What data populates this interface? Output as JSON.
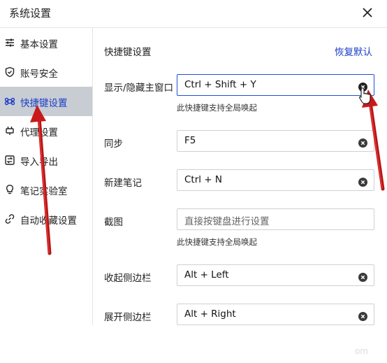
{
  "window": {
    "title": "系统设置",
    "close_icon": "close-icon"
  },
  "sidebar": {
    "items": [
      {
        "label": "基本设置",
        "icon": "sliders-icon",
        "active": false
      },
      {
        "label": "账号安全",
        "icon": "shield-icon",
        "active": false
      },
      {
        "label": "快捷键设置",
        "icon": "command-icon",
        "active": true
      },
      {
        "label": "代理设置",
        "icon": "plug-icon",
        "active": false
      },
      {
        "label": "导入导出",
        "icon": "import-export-icon",
        "active": false
      },
      {
        "label": "笔记实验室",
        "icon": "bulb-icon",
        "active": false
      },
      {
        "label": "自动收藏设置",
        "icon": "link-icon",
        "active": false
      }
    ]
  },
  "main": {
    "section_title": "快捷键设置",
    "restore_default": "恢复默认",
    "shortcuts": [
      {
        "label": "显示/隐藏主窗口",
        "value": "Ctrl + Shift + Y",
        "hint": "此快捷键支持全局唤起",
        "focused": true
      },
      {
        "label": "同步",
        "value": "F5"
      },
      {
        "label": "新建笔记",
        "value": "Ctrl + N"
      },
      {
        "label": "截图",
        "placeholder": "直接按键盘进行设置",
        "hint": "此快捷键支持全局唤起"
      },
      {
        "label": "收起侧边栏",
        "value": "Alt + Left"
      },
      {
        "label": "展开侧边栏",
        "value": "Alt + Right"
      }
    ]
  },
  "watermark": "om",
  "colors": {
    "accent": "#1a3fc7",
    "active_bg": "#c8ccd3",
    "annotation_arrow": "#d01818"
  }
}
